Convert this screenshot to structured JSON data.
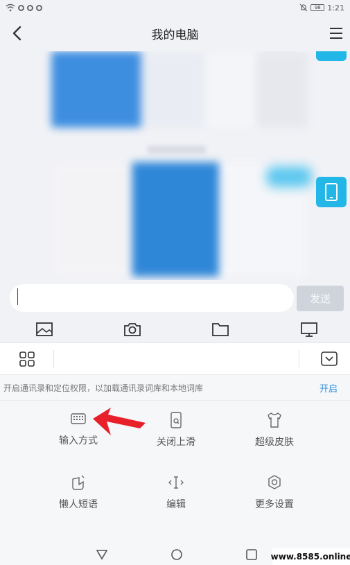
{
  "status_bar": {
    "battery": "98",
    "time": "1:21"
  },
  "header": {
    "title": "我的电脑"
  },
  "composer": {
    "placeholder": "",
    "send_label": "发送"
  },
  "keyboard": {
    "notice_text": "开启通讯录和定位权限，以加载通讯录词库和本地词库",
    "notice_action": "开启",
    "items": [
      {
        "label": "输入方式",
        "icon": "keyboard-icon"
      },
      {
        "label": "关闭上滑",
        "icon": "swipe-up-icon"
      },
      {
        "label": "超级皮肤",
        "icon": "shirt-icon"
      },
      {
        "label": "懒人短语",
        "icon": "quick-phrase-icon"
      },
      {
        "label": "编辑",
        "icon": "text-cursor-icon"
      },
      {
        "label": "更多设置",
        "icon": "gear-icon"
      }
    ]
  },
  "watermark": "www.8585.online",
  "colors": {
    "accent": "#23b7e8",
    "link": "#2a8fe0",
    "annotation": "#e8202a"
  }
}
